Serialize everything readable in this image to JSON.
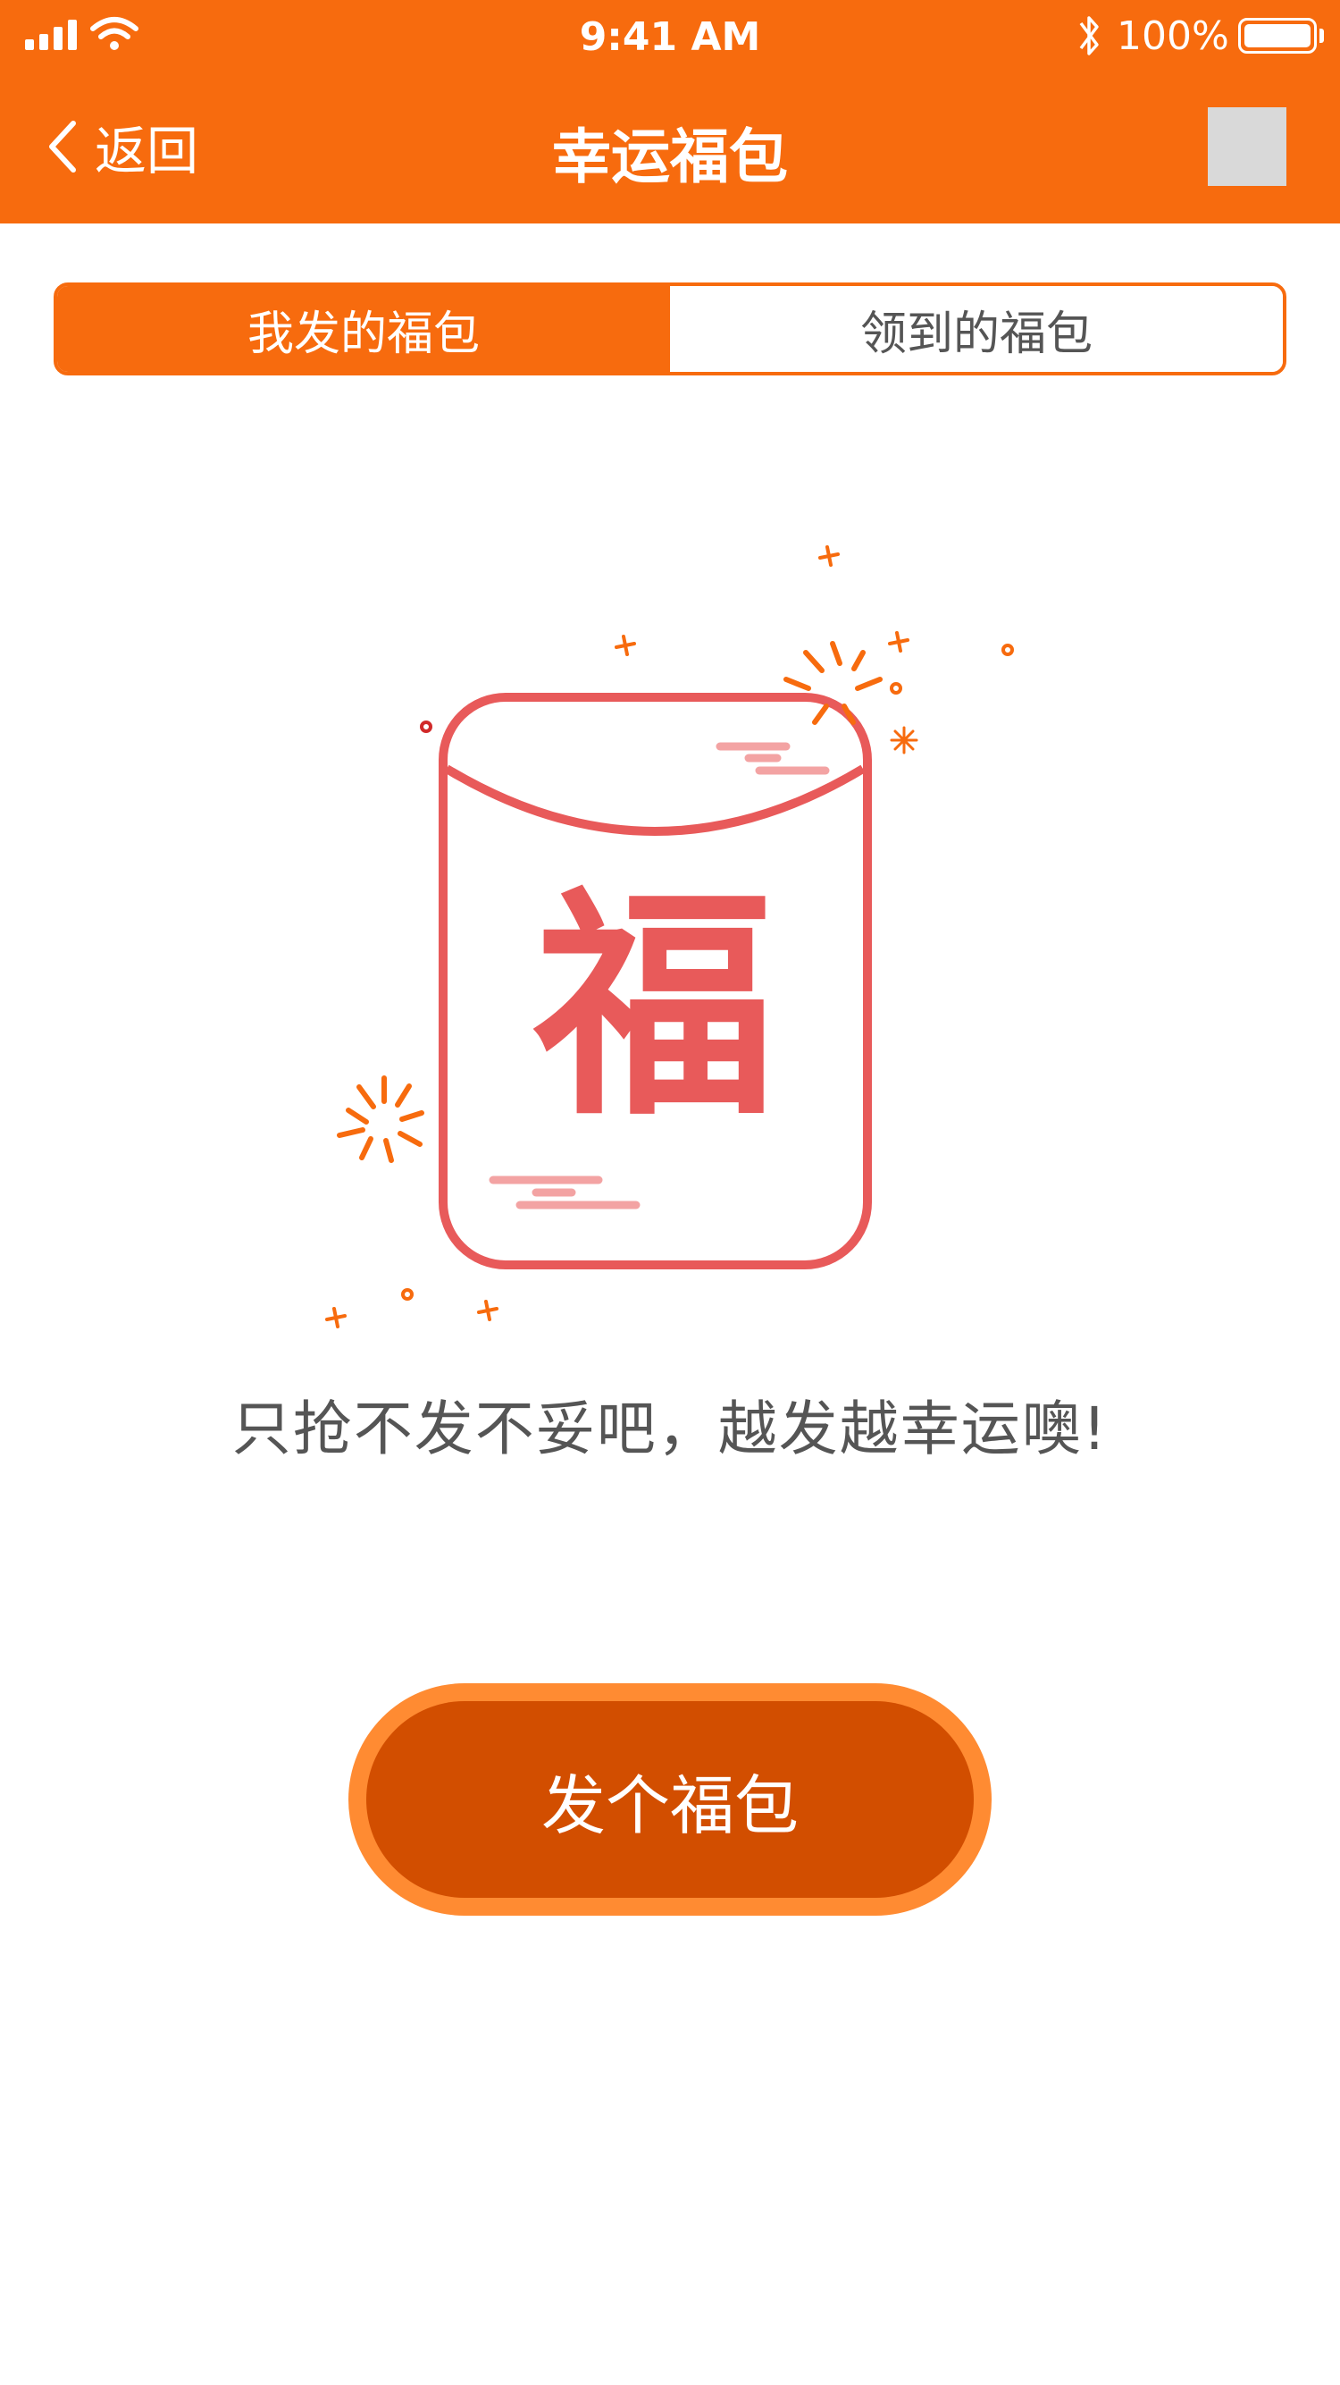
{
  "status_bar": {
    "time": "9:41 AM",
    "battery": "100%",
    "signal_icon": "cellular-signal-icon",
    "wifi_icon": "wifi-icon",
    "bluetooth_icon": "bluetooth-icon",
    "battery_icon": "battery-icon"
  },
  "nav": {
    "back_label": "返回",
    "title": "幸运福包",
    "back_icon": "chevron-left-icon",
    "right_placeholder_color": "#D9D9D9"
  },
  "tabs": [
    {
      "label": "我发的福包",
      "active": true
    },
    {
      "label": "领到的福包",
      "active": false
    }
  ],
  "illustration": {
    "character": "福",
    "icon": "lucky-red-envelope-icon"
  },
  "empty_state": {
    "message": "只抢不发不妥吧，越发越幸运噢!"
  },
  "cta": {
    "label": "发个福包"
  },
  "colors": {
    "brand_orange": "#F76B0E",
    "button_dark": "#D24E00",
    "button_ring": "#FF8B32",
    "envelope_red": "#E85A5A"
  }
}
